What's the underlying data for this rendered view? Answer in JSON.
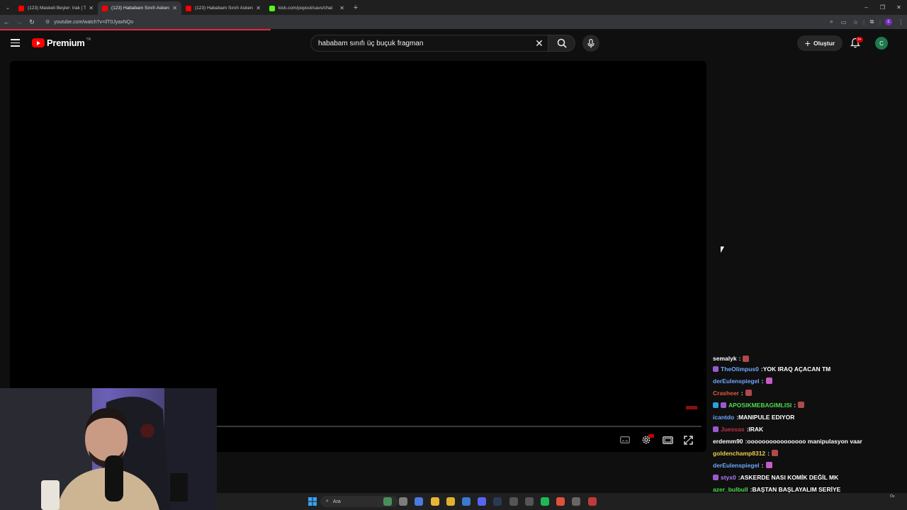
{
  "browser": {
    "tabs": [
      {
        "title": "(123) Maskeli Beşler: Irak | Tek P",
        "favicon_color": "#ff0000",
        "active": false
      },
      {
        "title": "(123) Hababam Sınıfı Askerde | ",
        "favicon_color": "#ff0000",
        "active": true
      },
      {
        "title": "(123) Hababam Sınıfı Askerde | ",
        "favicon_color": "#ff0000",
        "active": false
      },
      {
        "title": "kick.com/popout/cavs/chat",
        "favicon_color": "#53fc18",
        "active": false
      }
    ],
    "url": "youtube.com/watch?v=ilT0JyaxNQo",
    "profile_initial": "c"
  },
  "masthead": {
    "logo_text": "Premium",
    "region": "TR",
    "search_query": "hababam sınıfı üç buçuk fragman",
    "create_label": "Oluştur",
    "notification_count": "9+",
    "avatar_initial": "C"
  },
  "colors": {
    "yt_red": "#ff0000",
    "accent_green": "#53fc18",
    "background": "#0f0f0f"
  },
  "chat": [
    {
      "user": "semalyk",
      "user_color": "#ffffff",
      "badges": [],
      "msg": "",
      "emote_color": "#b04a4a",
      "partial": true
    },
    {
      "user": "TheOlimpus0",
      "user_color": "#6fa8ff",
      "badges": [
        "purple"
      ],
      "msg": "YOK IRAQ AÇACAN TM",
      "emote_color": null
    },
    {
      "user": "derEulenspiegel",
      "user_color": "#6fa8ff",
      "badges": [],
      "msg": "",
      "emote_color": "#c65cc6"
    },
    {
      "user": "Crasheer",
      "user_color": "#e05a3a",
      "badges": [],
      "msg": "",
      "emote_color": "#b04a4a"
    },
    {
      "user": "APOSIKMEBAGIMLISI",
      "user_color": "#4cdc4c",
      "badges": [
        "blue",
        "purple"
      ],
      "msg": "",
      "emote_color": "#b04a4a"
    },
    {
      "user": "icantdo",
      "user_color": "#6fa8ff",
      "badges": [],
      "msg": "MANIPULE EDIYOR",
      "emote_color": null
    },
    {
      "user": "Juessas",
      "user_color": "#c0304a",
      "badges": [
        "purple"
      ],
      "msg": "IRAK",
      "emote_color": null
    },
    {
      "user": "erdemm90",
      "user_color": "#ffffff",
      "badges": [],
      "msg": "oooooooooooooooo manipulasyon vaar",
      "emote_color": null
    },
    {
      "user": "goldenchamp8312",
      "user_color": "#e8d04a",
      "badges": [],
      "msg": "",
      "emote_color": "#b04a4a"
    },
    {
      "user": "derEulenspiegel",
      "user_color": "#6fa8ff",
      "badges": [],
      "msg": "",
      "emote_color": "#c65cc6"
    },
    {
      "user": "styx0",
      "user_color": "#b07cff",
      "badges": [
        "purple"
      ],
      "msg": "ASKERDE NASI KOMİK DEĞİL MK",
      "emote_color": null
    },
    {
      "user": "azer_bulbull",
      "user_color": "#4cdc4c",
      "badges": [],
      "msg": "BAŞTAN BAŞLAYALIM SERİYE",
      "emote_color": null
    }
  ],
  "taskbar": {
    "search_label": "Ara",
    "icons": [
      {
        "name": "widgets-icon",
        "color": "#4a8f5a"
      },
      {
        "name": "task-view-icon",
        "color": "#7d7d7d"
      },
      {
        "name": "copilot-icon",
        "color": "#4c7ae0"
      },
      {
        "name": "chrome-icon",
        "color": "#e8b43a"
      },
      {
        "name": "file-explorer-icon",
        "color": "#e0b030"
      },
      {
        "name": "ccleaner-icon",
        "color": "#3a7ad0"
      },
      {
        "name": "discord-icon",
        "color": "#5865f2"
      },
      {
        "name": "steam-icon",
        "color": "#2a3a55"
      },
      {
        "name": "app-icon",
        "color": "#555555"
      },
      {
        "name": "obs-icon",
        "color": "#555555"
      },
      {
        "name": "spotify-icon",
        "color": "#1db954"
      },
      {
        "name": "chrome-icon-2",
        "color": "#e0503a"
      },
      {
        "name": "app-icon-2",
        "color": "#666666"
      },
      {
        "name": "app-icon-3",
        "color": "#c03a3a"
      }
    ],
    "clock": "Ös"
  }
}
